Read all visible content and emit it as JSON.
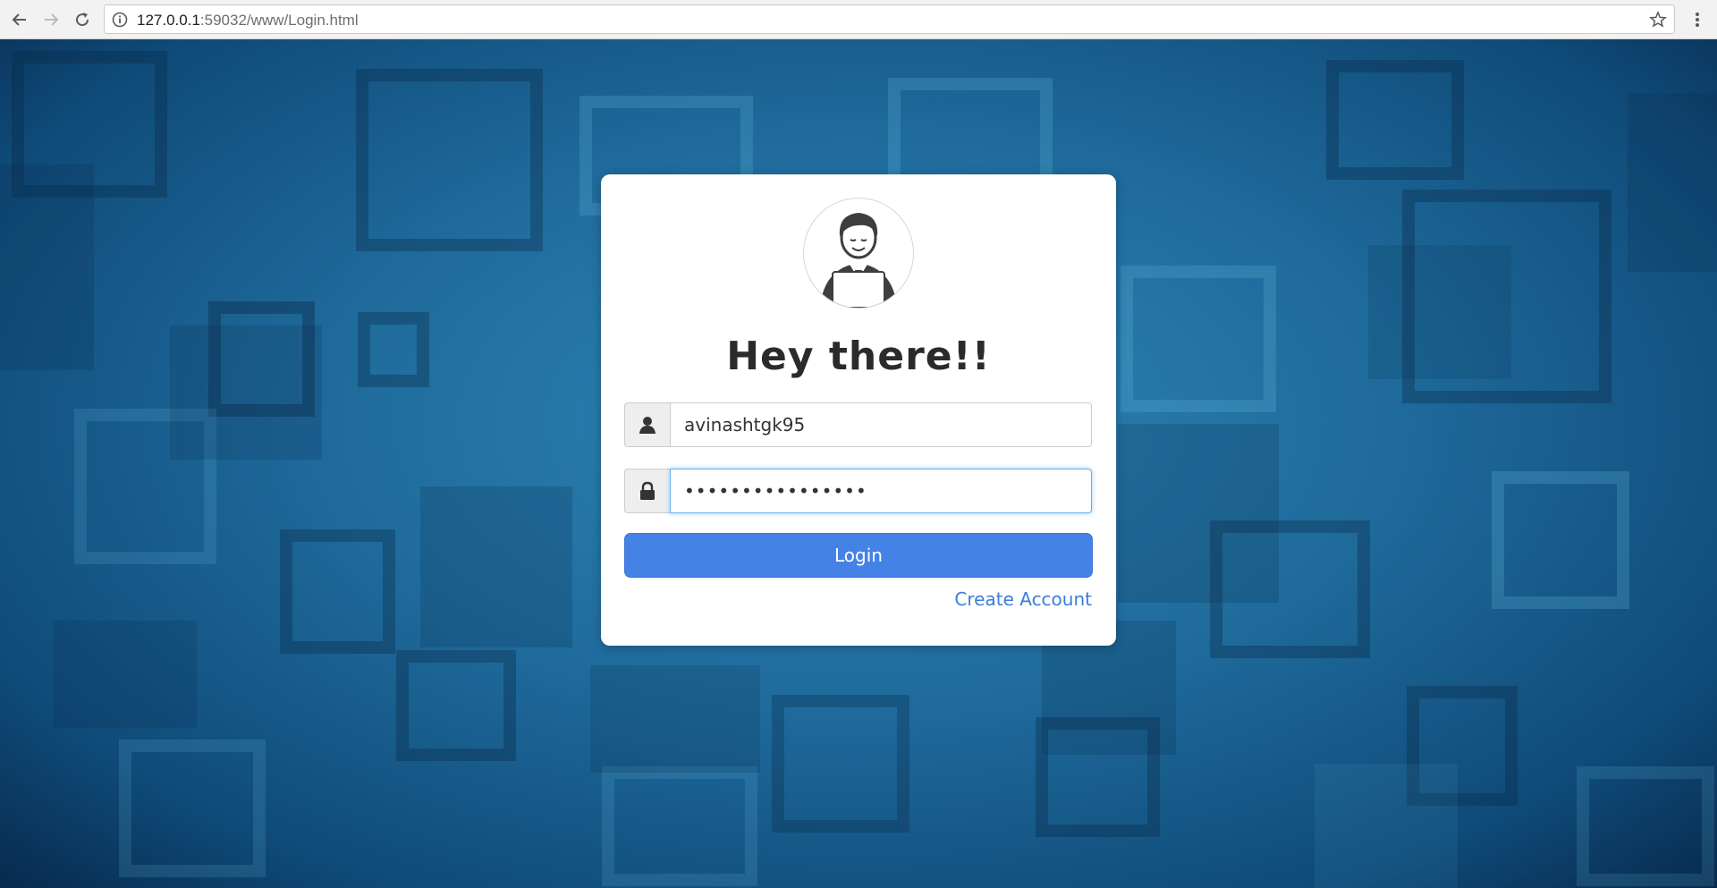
{
  "browser": {
    "url_host": "127.0.0.1",
    "url_path": ":59032/www/Login.html",
    "icons": [
      "back-arrow-icon",
      "forward-arrow-icon",
      "reload-icon",
      "info-icon",
      "star-icon",
      "kebab-menu-icon"
    ]
  },
  "login": {
    "heading": "Hey there!!",
    "username_value": "avinashtgk95",
    "password_value": "••••••••••••••••",
    "login_label": "Login",
    "create_account_label": "Create Account",
    "icons": [
      "user-icon",
      "lock-icon",
      "avatar-person-laptop-icon"
    ]
  },
  "colors": {
    "accent": "#4582e6",
    "link": "#3b7ddd",
    "background_mid": "#1e6a9b",
    "background_edge": "#072a4e"
  }
}
